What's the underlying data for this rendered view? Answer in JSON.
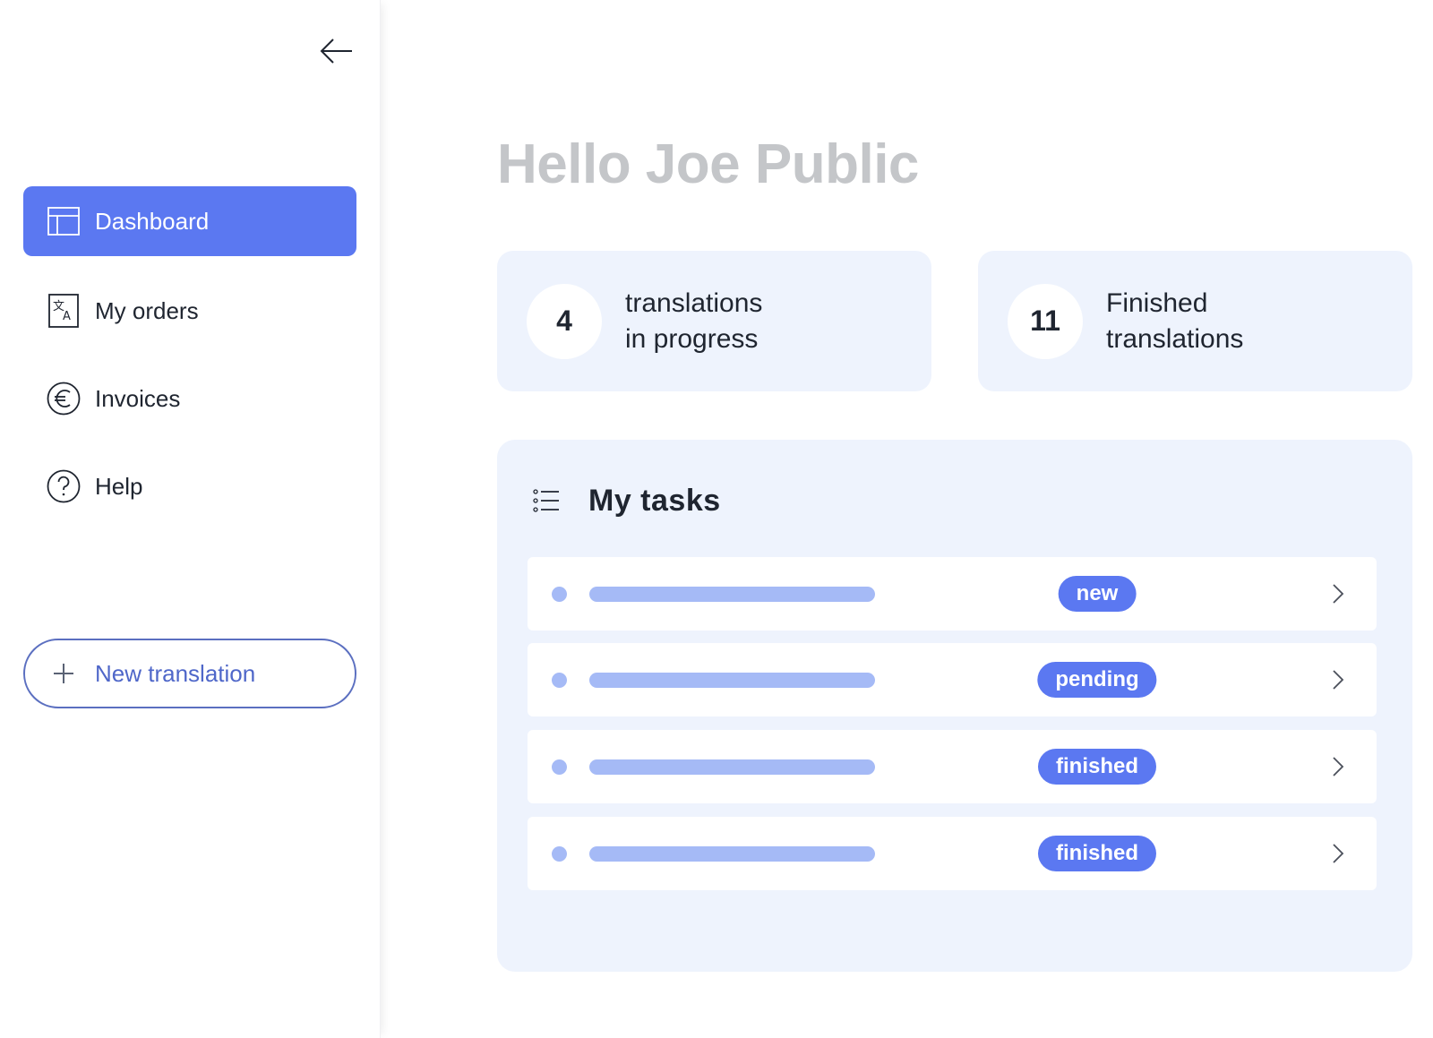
{
  "sidebar": {
    "collapse_icon": "arrow-left-icon",
    "items": [
      {
        "label": "Dashboard",
        "icon": "layout-icon",
        "active": true
      },
      {
        "label": "My orders",
        "icon": "translate-icon",
        "active": false
      },
      {
        "label": "Invoices",
        "icon": "euro-icon",
        "active": false
      },
      {
        "label": "Help",
        "icon": "help-icon",
        "active": false
      }
    ],
    "new_button": {
      "label": "New translation",
      "icon": "plus-icon"
    }
  },
  "main": {
    "greeting": "Hello Joe Public",
    "stats": [
      {
        "value": "4",
        "label_line1": "translations",
        "label_line2": "in progress"
      },
      {
        "value": "11",
        "label_line1": "Finished",
        "label_line2": "translations"
      }
    ],
    "tasks": {
      "title": "My tasks",
      "icon": "list-icon",
      "rows": [
        {
          "status": "new"
        },
        {
          "status": "pending"
        },
        {
          "status": "finished"
        },
        {
          "status": "finished"
        }
      ]
    }
  },
  "colors": {
    "accent": "#5b78f1",
    "placeholder": "#a5baf6",
    "panel_bg": "#eef3fd",
    "greeting": "#c4c6c9",
    "outline_button": "#5b6fc0"
  }
}
